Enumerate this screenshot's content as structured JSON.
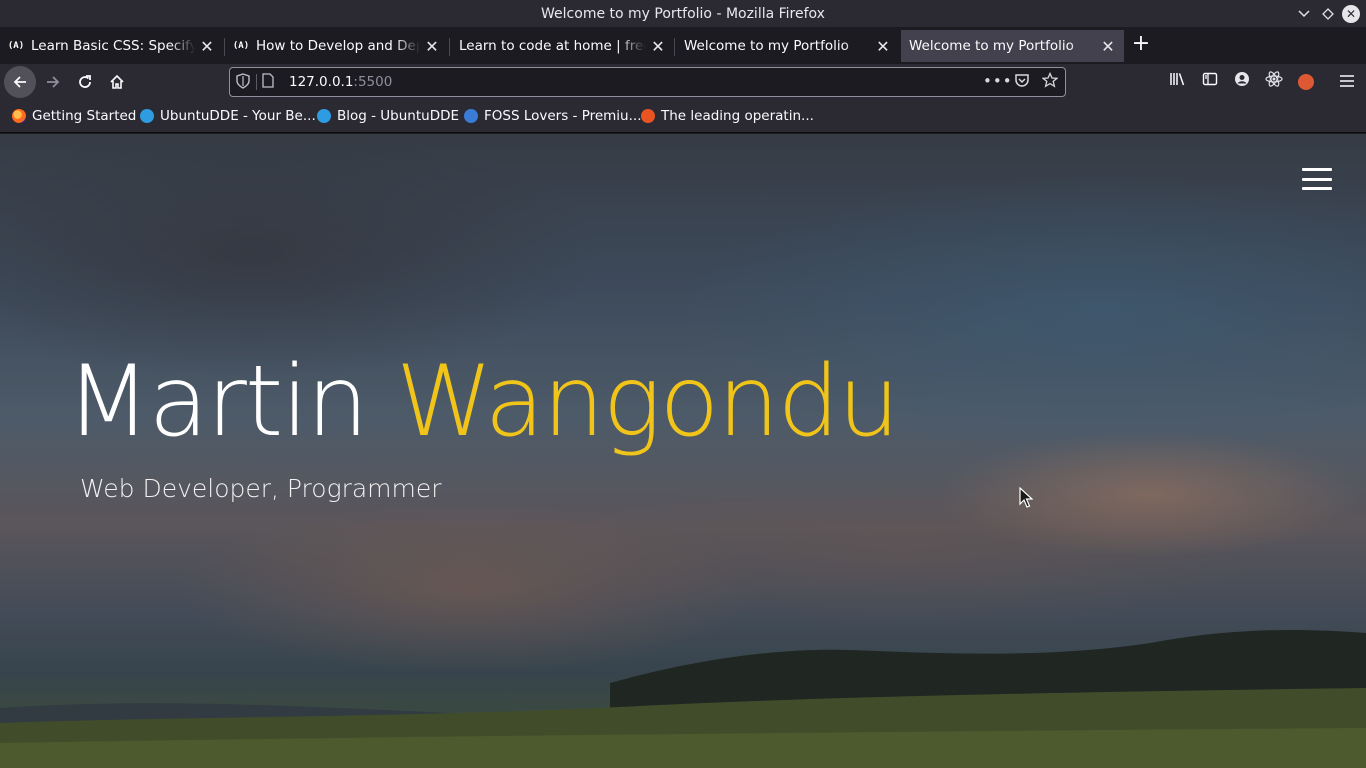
{
  "window": {
    "title": "Welcome to my Portfolio - Mozilla Firefox"
  },
  "tabs": [
    {
      "label": "Learn Basic CSS: Specify How",
      "favicon": "freecodecamp-icon",
      "active": false
    },
    {
      "label": "How to Develop and Deploy",
      "favicon": "freecodecamp-icon",
      "active": false
    },
    {
      "label": "Learn to code at home | freeCodeCamp",
      "favicon": "",
      "active": false
    },
    {
      "label": "Welcome to my Portfolio",
      "favicon": "",
      "active": false
    },
    {
      "label": "Welcome to my Portfolio",
      "favicon": "",
      "active": true
    }
  ],
  "favicon_text": "(A)",
  "navbar": {
    "url_host": "127.0.0.1",
    "url_port": ":5500",
    "dots": "•••"
  },
  "bookmarks": [
    {
      "label": "Getting Started",
      "icon": "firefox-icon"
    },
    {
      "label": "UbuntuDDE - Your Be...",
      "icon": "ubuntudde-icon"
    },
    {
      "label": "Blog - UbuntuDDE",
      "icon": "ubuntudde-icon"
    },
    {
      "label": "FOSS Lovers - Premiu...",
      "icon": "foss-lovers-icon"
    },
    {
      "label": "The leading operatin...",
      "icon": "ubuntu-icon"
    }
  ],
  "hero": {
    "first_name": "Martin",
    "last_name": "Wangondu",
    "subtitle": "Web Developer, Programmer"
  },
  "colors": {
    "accent_name": "#f0c419",
    "browser_bg": "#2b2a33"
  }
}
